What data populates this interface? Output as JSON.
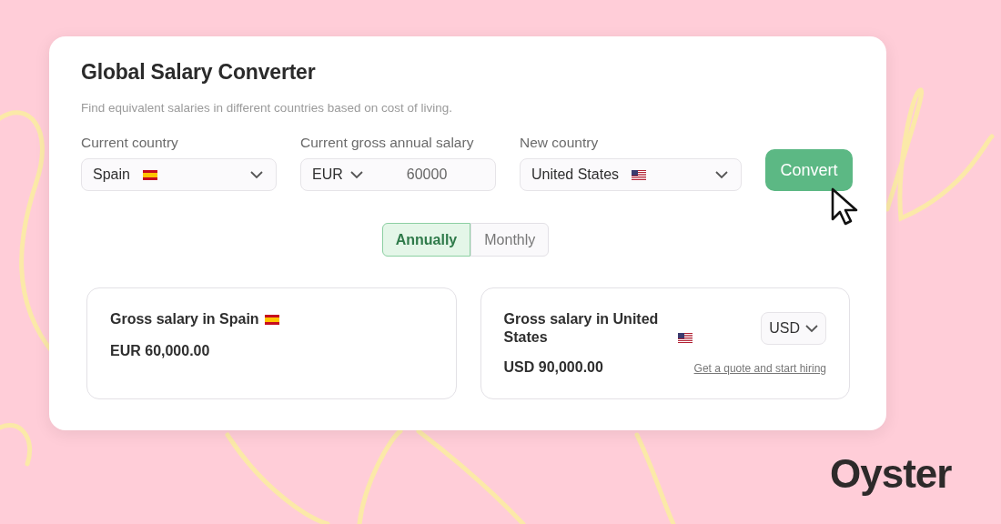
{
  "title": "Global Salary Converter",
  "subtitle": "Find equivalent salaries in different countries based on cost of living.",
  "fields": [
    {
      "kind": "select",
      "label": "Current country",
      "value": "Spain"
    },
    {
      "kind": "amount",
      "label": "Current gross annual salary",
      "currency": "EUR",
      "value": "60000"
    },
    {
      "kind": "select",
      "label": "New country",
      "value": "United States"
    }
  ],
  "convert_button": "Convert",
  "period_toggle": [
    {
      "label": "Annually",
      "selected": true
    },
    {
      "label": "Monthly",
      "selected": false
    }
  ],
  "results": [
    {
      "title": "Gross salary in Spain",
      "amount": "EUR 60,000.00"
    },
    {
      "title": "Gross salary in United States",
      "amount": "USD 90,000.00",
      "currency": "USD",
      "link": "Get a quote and start hiring"
    }
  ],
  "brand": "Oyster"
}
